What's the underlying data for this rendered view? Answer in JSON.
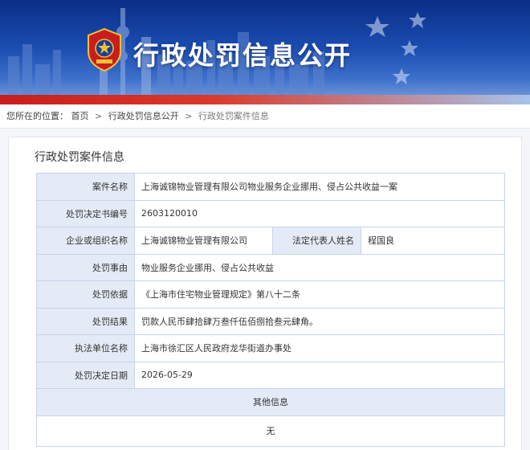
{
  "banner": {
    "title": "行政处罚信息公开",
    "colors": {
      "sky": "#1a4cb0",
      "red": "#c81e1e"
    }
  },
  "breadcrumb": {
    "prefix": "您所在的位置：",
    "items": [
      "首页",
      "行政处罚信息公开",
      "行政处罚案件信息"
    ],
    "separator": ">"
  },
  "panel": {
    "title": "行政处罚案件信息"
  },
  "case": {
    "name_label": "案件名称",
    "name_value": "上海诚锦物业管理有限公司物业服务企业挪用、侵占公共收益一案",
    "doc_no_label": "处罚决定书编号",
    "doc_no_value": "2603120010",
    "org_label": "企业或组织名称",
    "org_value": "上海诚锦物业管理有限公司",
    "rep_label": "法定代表人姓名",
    "rep_value": "程国良",
    "reason_label": "处罚事由",
    "reason_value": "物业服务企业挪用、侵占公共收益",
    "basis_label": "处罚依据",
    "basis_value": "《上海市住宅物业管理规定》第八十二条",
    "result_label": "处罚结果",
    "result_value": "罚款人民币肆拾肆万叁仟伍佰捌拾叁元肆角。",
    "unit_label": "执法单位名称",
    "unit_value": "上海市徐汇区人民政府龙华街道办事处",
    "date_label": "处罚决定日期",
    "date_value": "2026-05-29",
    "other_label": "其他信息",
    "other_value": "无"
  }
}
